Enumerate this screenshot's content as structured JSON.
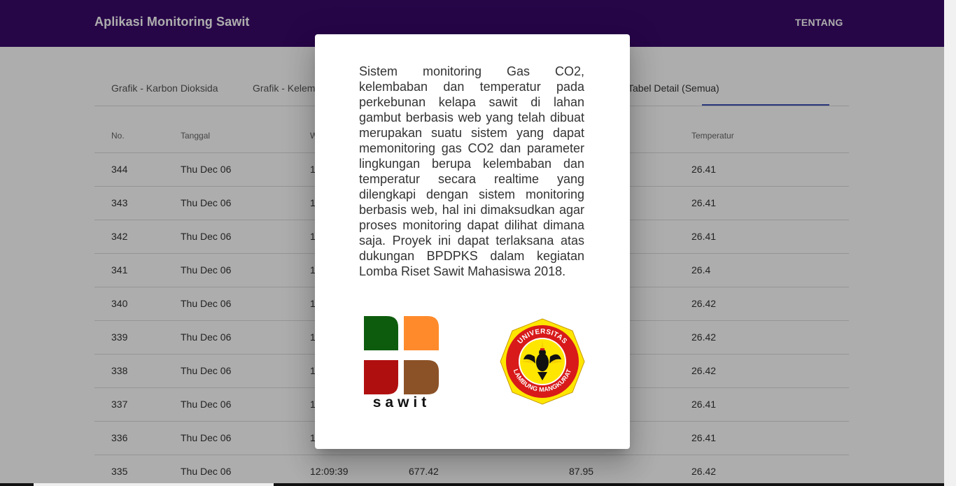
{
  "app": {
    "title": "Aplikasi Monitoring Sawit",
    "nav_about": "TENTANG"
  },
  "tabs": [
    {
      "label": "Grafik - Karbon Dioksida"
    },
    {
      "label": "Grafik - Kelem"
    },
    {
      "label": "Tabel Detail (Semua)"
    }
  ],
  "table": {
    "headers": [
      "No.",
      "Tanggal",
      "W",
      "",
      "",
      "Temperatur"
    ],
    "rows": [
      {
        "no": "344",
        "tanggal": "Thu Dec 06",
        "waktu": "1",
        "co2": "",
        "kelembaban": "",
        "temperatur": "26.41"
      },
      {
        "no": "343",
        "tanggal": "Thu Dec 06",
        "waktu": "1",
        "co2": "",
        "kelembaban": "",
        "temperatur": "26.41"
      },
      {
        "no": "342",
        "tanggal": "Thu Dec 06",
        "waktu": "1",
        "co2": "",
        "kelembaban": "",
        "temperatur": "26.41"
      },
      {
        "no": "341",
        "tanggal": "Thu Dec 06",
        "waktu": "1",
        "co2": "",
        "kelembaban": "",
        "temperatur": "26.4"
      },
      {
        "no": "340",
        "tanggal": "Thu Dec 06",
        "waktu": "1",
        "co2": "",
        "kelembaban": "",
        "temperatur": "26.42"
      },
      {
        "no": "339",
        "tanggal": "Thu Dec 06",
        "waktu": "1",
        "co2": "",
        "kelembaban": "",
        "temperatur": "26.42"
      },
      {
        "no": "338",
        "tanggal": "Thu Dec 06",
        "waktu": "1",
        "co2": "",
        "kelembaban": "",
        "temperatur": "26.42"
      },
      {
        "no": "337",
        "tanggal": "Thu Dec 06",
        "waktu": "1",
        "co2": "",
        "kelembaban": "",
        "temperatur": "26.41"
      },
      {
        "no": "336",
        "tanggal": "Thu Dec 06",
        "waktu": "1",
        "co2": "",
        "kelembaban": "",
        "temperatur": "26.41"
      },
      {
        "no": "335",
        "tanggal": "Thu Dec 06",
        "waktu": "12:09:39",
        "co2": "677.42",
        "kelembaban": "87.95",
        "temperatur": "26.42"
      }
    ]
  },
  "modal": {
    "text": "Sistem monitoring Gas CO2, kelembaban dan temperatur pada perkebunan kelapa sawit di lahan gambut berbasis web yang telah dibuat merupakan suatu sistem yang dapat memonitoring gas CO2 dan parameter lingkungan berupa kelembaban dan temperatur secara realtime yang dilengkapi dengan sistem monitoring berbasis web, hal ini dimaksudkan agar proses monitoring dapat dilihat dimana saja. Proyek ini dapat terlaksana atas dukungan BPDPKS dalam kegiatan Lomba Riset Sawit Mahasiswa 2018.",
    "logo_sawit_text": "sawit",
    "logo_ulm_text": "UNIVERSITAS LAMBUNG MANGKURAT"
  },
  "colors": {
    "header": "#3a0a6a",
    "tab_indicator": "#3f51b5",
    "sawit_green": "#0d5c0d",
    "sawit_orange": "#ff8a2b",
    "sawit_red": "#b00f0f",
    "sawit_brown": "#8b5227",
    "ulm_yellow": "#ffe600",
    "ulm_red": "#d81a1a"
  }
}
